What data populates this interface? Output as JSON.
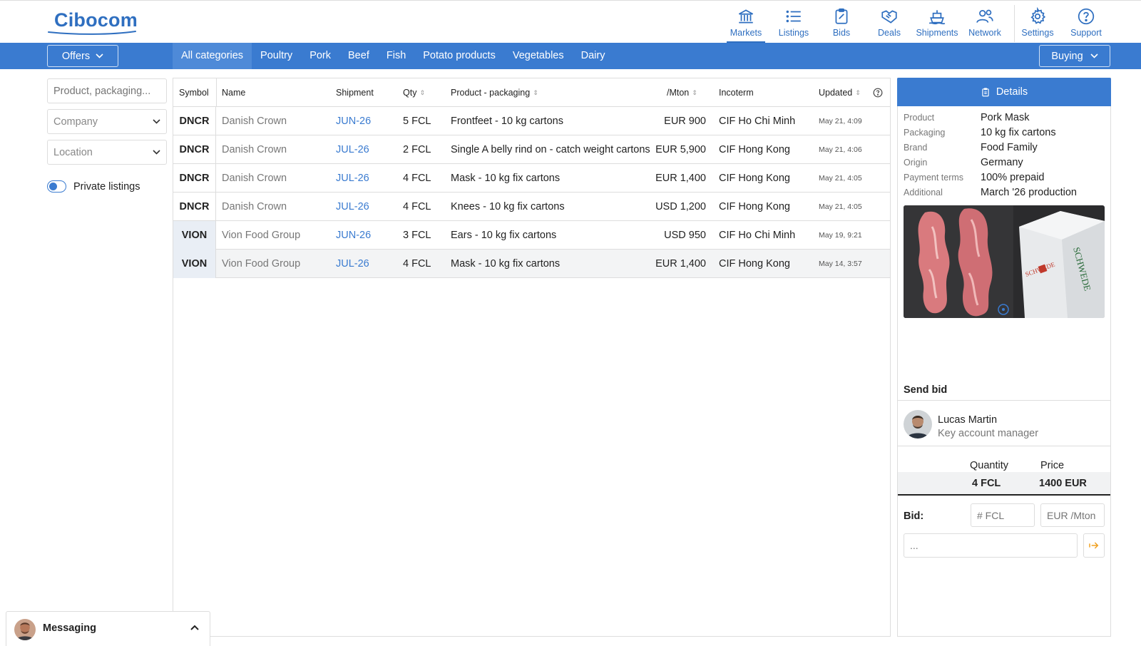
{
  "app": {
    "logo_text": "Cibocom"
  },
  "nav": {
    "items": [
      {
        "label": "Markets",
        "icon": "bank-icon"
      },
      {
        "label": "Listings",
        "icon": "list-icon"
      },
      {
        "label": "Bids",
        "icon": "clipboard-icon"
      },
      {
        "label": "Deals",
        "icon": "handshake-icon"
      },
      {
        "label": "Shipments",
        "icon": "ship-icon"
      },
      {
        "label": "Network",
        "icon": "users-icon"
      },
      {
        "label": "Settings",
        "icon": "gear-icon"
      },
      {
        "label": "Support",
        "icon": "question-icon"
      }
    ],
    "active": "Markets"
  },
  "catbar": {
    "offers_label": "Offers",
    "buying_label": "Buying",
    "categories": [
      "All categories",
      "Poultry",
      "Pork",
      "Beef",
      "Fish",
      "Potato products",
      "Vegetables",
      "Dairy"
    ],
    "active_category": "All categories"
  },
  "filters": {
    "search_placeholder": "Product, packaging...",
    "company_label": "Company",
    "location_label": "Location",
    "private_listings_label": "Private listings",
    "private_listings_on": true
  },
  "table": {
    "headers": {
      "symbol": "Symbol",
      "name": "Name",
      "shipment": "Shipment",
      "qty": "Qty",
      "product": "Product - packaging",
      "price": "/Mton",
      "incoterm": "Incoterm",
      "updated": "Updated"
    },
    "rows": [
      {
        "symbol": "DNCR",
        "name": "Danish Crown",
        "shipment": "JUN-26",
        "qty": "5 FCL",
        "product": "Frontfeet - 10 kg cartons",
        "price": "EUR 900",
        "incoterm": "CIF Ho Chi Minh",
        "updated": "May 21, 4:09"
      },
      {
        "symbol": "DNCR",
        "name": "Danish Crown",
        "shipment": "JUL-26",
        "qty": "2 FCL",
        "product": "Single A belly rind on - catch weight cartons",
        "price": "EUR 5,900",
        "incoterm": "CIF Hong Kong",
        "updated": "May 21, 4:06"
      },
      {
        "symbol": "DNCR",
        "name": "Danish Crown",
        "shipment": "JUL-26",
        "qty": "4 FCL",
        "product": "Mask - 10 kg fix cartons",
        "price": "EUR 1,400",
        "incoterm": "CIF Hong Kong",
        "updated": "May 21, 4:05"
      },
      {
        "symbol": "DNCR",
        "name": "Danish Crown",
        "shipment": "JUL-26",
        "qty": "4 FCL",
        "product": "Knees - 10 kg fix cartons",
        "price": "USD 1,200",
        "incoterm": "CIF Hong Kong",
        "updated": "May 21, 4:05"
      },
      {
        "symbol": "VION",
        "name": "Vion Food Group",
        "shipment": "JUN-26",
        "qty": "3 FCL",
        "product": "Ears - 10 kg fix cartons",
        "price": "USD 950",
        "incoterm": "CIF Ho Chi Minh",
        "updated": "May 19, 9:21"
      },
      {
        "symbol": "VION",
        "name": "Vion Food Group",
        "shipment": "JUL-26",
        "qty": "4 FCL",
        "product": "Mask - 10 kg fix cartons",
        "price": "EUR 1,400",
        "incoterm": "CIF Hong Kong",
        "updated": "May 14, 3:57"
      }
    ],
    "selected_row": 5
  },
  "details": {
    "title": "Details",
    "fields": [
      {
        "label": "Product",
        "value": "Pork Mask"
      },
      {
        "label": "Packaging",
        "value": "10 kg fix cartons"
      },
      {
        "label": "Brand",
        "value": "Food Family"
      },
      {
        "label": "Origin",
        "value": "Germany"
      },
      {
        "label": "Payment terms",
        "value": "100% prepaid"
      },
      {
        "label": "Additional",
        "value": "March '26 production"
      }
    ],
    "send_bid_title": "Send bid",
    "rep_name": "Lucas Martin",
    "rep_role": "Key account manager",
    "quantity_label": "Quantity",
    "price_label": "Price",
    "quantity_value": "4 FCL",
    "price_value": "1400 EUR",
    "bid_label": "Bid:",
    "fcl_placeholder": "# FCL",
    "price_placeholder": "EUR /Mton",
    "message_placeholder": "..."
  },
  "messaging": {
    "label": "Messaging"
  },
  "colors": {
    "brand_blue": "#3a7bd0",
    "link_blue": "#2f6fc0",
    "send_orange": "#f0a020"
  }
}
